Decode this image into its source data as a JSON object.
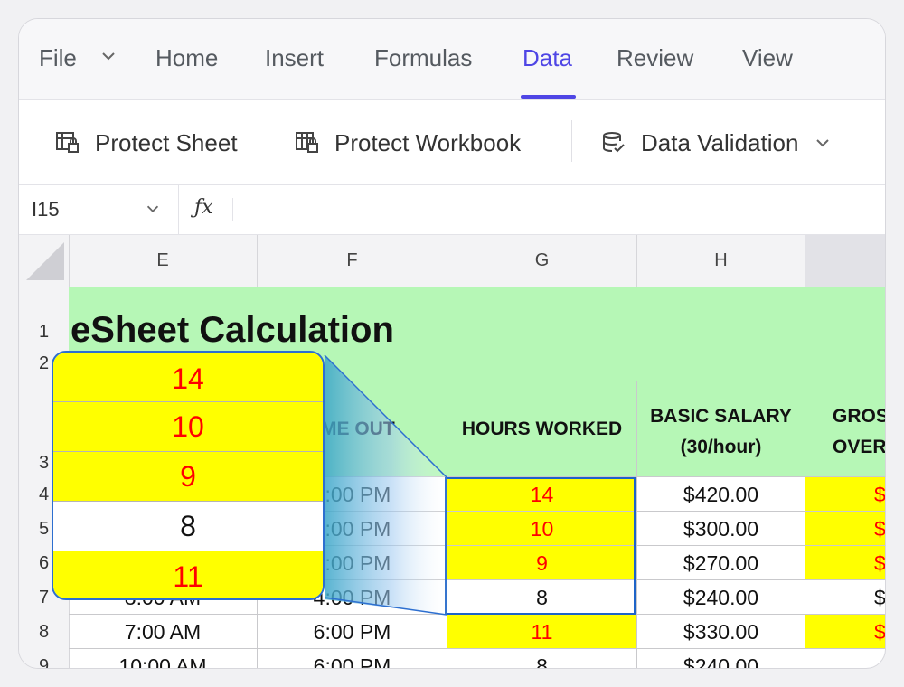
{
  "menu": {
    "file": "File",
    "tabs": [
      "Home",
      "Insert",
      "Formulas",
      "Data",
      "Review",
      "View"
    ],
    "active_tab": "Data"
  },
  "toolbar": {
    "protect_sheet": "Protect Sheet",
    "protect_workbook": "Protect Workbook",
    "data_validation": "Data Validation"
  },
  "formula_bar": {
    "name_box": "I15",
    "fx_label": "ƒx",
    "formula": ""
  },
  "columns": [
    "E",
    "F",
    "G",
    "H"
  ],
  "rows": [
    "1",
    "2",
    "3",
    "4",
    "5",
    "6",
    "7",
    "8",
    "9"
  ],
  "sheet": {
    "title": "eSheet Calculation",
    "headers": {
      "time_out": "ME OUT",
      "hours_worked": "HOURS WORKED",
      "basic_salary_line1": "BASIC SALARY",
      "basic_salary_line2": "(30/hour)",
      "gross_line1": "GROS",
      "gross_line2": "OVERTI"
    },
    "data": [
      {
        "time_in": "",
        "time_out": "9:00 PM",
        "hours": "14",
        "salary": "$420.00",
        "gross": "$",
        "highlight": true
      },
      {
        "time_in": "",
        "time_out": "7:00 PM",
        "hours": "10",
        "salary": "$300.00",
        "gross": "$",
        "highlight": true
      },
      {
        "time_in": "",
        "time_out": "6:00 PM",
        "hours": "9",
        "salary": "$270.00",
        "gross": "$",
        "highlight": true
      },
      {
        "time_in": "8:00 AM",
        "time_out": "4:00 PM",
        "hours": "8",
        "salary": "$240.00",
        "gross": "$",
        "highlight": false
      },
      {
        "time_in": "7:00 AM",
        "time_out": "6:00 PM",
        "hours": "11",
        "salary": "$330.00",
        "gross": "$",
        "highlight": true
      },
      {
        "time_in": "10:00 AM",
        "time_out": "6:00 PM",
        "hours": "8",
        "salary": "$240.00",
        "gross": "",
        "highlight": false
      }
    ]
  },
  "magnifier": {
    "values": [
      "14",
      "10",
      "9",
      "8",
      "11"
    ],
    "highlight": [
      true,
      true,
      true,
      false,
      true
    ]
  },
  "colors": {
    "accent": "#4f46e5",
    "title_fill": "#b6f7b6",
    "highlight_fill": "#ffff00",
    "highlight_text": "#ff0000",
    "selection_border": "#1e64c8"
  }
}
